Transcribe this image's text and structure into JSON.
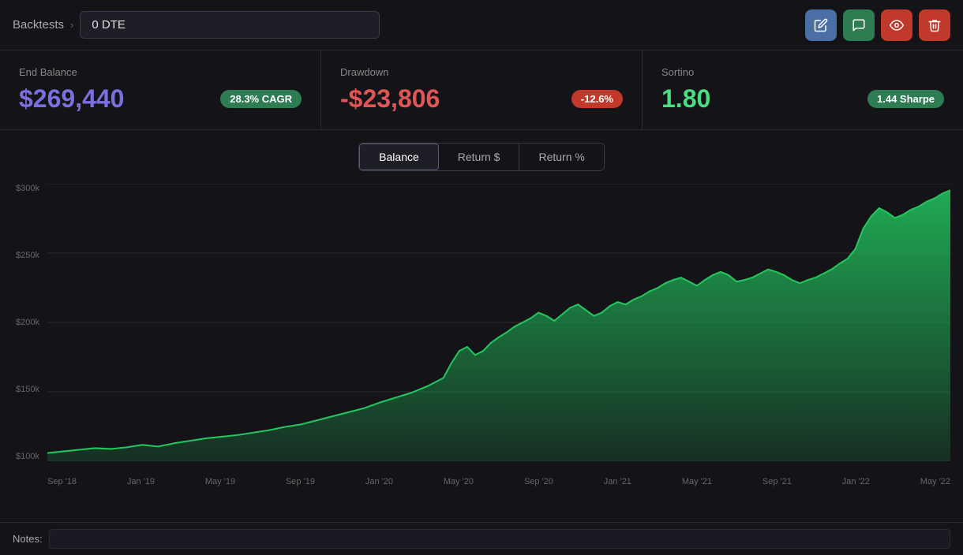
{
  "header": {
    "breadcrumb": "Backtests",
    "strategy_name": "0 DTE"
  },
  "actions": {
    "edit_label": "✏️",
    "copy_label": "💬",
    "view_label": "👁",
    "delete_label": "🗑"
  },
  "metrics": {
    "end_balance": {
      "label": "End Balance",
      "value": "$269,440",
      "badge": "28.3% CAGR",
      "badge_type": "green"
    },
    "drawdown": {
      "label": "Drawdown",
      "value": "-$23,806",
      "badge": "-12.6%",
      "badge_type": "red"
    },
    "sortino": {
      "label": "Sortino",
      "value": "1.80",
      "badge": "1.44 Sharpe",
      "badge_type": "green"
    }
  },
  "tabs": {
    "items": [
      "Balance",
      "Return $",
      "Return %"
    ],
    "active": 0
  },
  "chart": {
    "y_labels": [
      "$300k",
      "$250k",
      "$200k",
      "$150k",
      "$100k"
    ],
    "x_labels": [
      "Sep '18",
      "Jan '19",
      "May '19",
      "Sep '19",
      "Jan '20",
      "May '20",
      "Sep '20",
      "Jan '21",
      "May '21",
      "Sep '21",
      "Jan '22",
      "May '22"
    ]
  },
  "notes": {
    "label": "Notes:",
    "placeholder": ""
  }
}
